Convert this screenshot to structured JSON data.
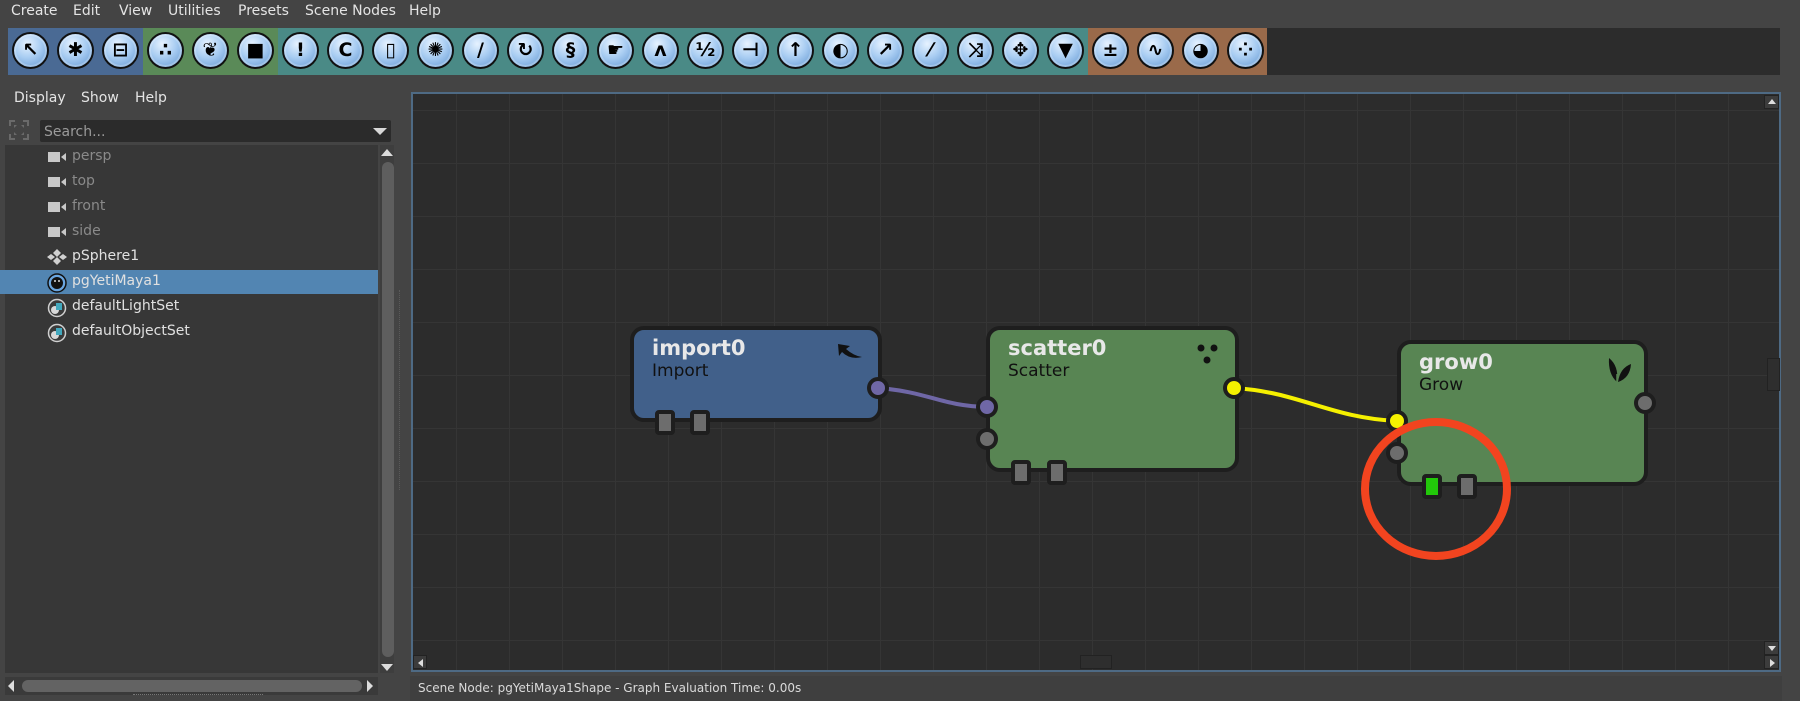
{
  "menubar": {
    "items": [
      "Create",
      "Edit",
      "View",
      "Utilities",
      "Presets",
      "Scene Nodes",
      "Help"
    ]
  },
  "toolbar": {
    "groups": [
      {
        "name": "blue",
        "color": "#4a6a94",
        "icons": [
          "import-icon",
          "puzzle-icon",
          "archive-box-icon"
        ]
      },
      {
        "name": "green",
        "color": "#5a8a58",
        "icons": [
          "scatter-icon",
          "grow-leaf-icon",
          "bucket-icon"
        ]
      },
      {
        "name": "teal",
        "color": "#4a8a86",
        "icons": [
          "exclamation-icon",
          "curl-icon",
          "blender-icon",
          "clump-icon",
          "comb-icon",
          "swirl-icon",
          "squiggle-icon",
          "pointing-hand-icon",
          "noise-icon",
          "split-icon",
          "signpost-icon",
          "direction-arrow-icon",
          "moon-icon",
          "graph-line-icon",
          "brush-icon",
          "shuffle-icon",
          "move-icon",
          "funnel-icon"
        ]
      },
      {
        "name": "brown",
        "color": "#9a6a4a",
        "icons": [
          "calculator-icon",
          "waveform-icon",
          "palette-icon",
          "dot-grid-icon"
        ]
      }
    ],
    "glyphs": {
      "import-icon": "↖",
      "puzzle-icon": "✱",
      "archive-box-icon": "⊟",
      "scatter-icon": "∴",
      "grow-leaf-icon": "❦",
      "bucket-icon": "■",
      "exclamation-icon": "!",
      "curl-icon": "C",
      "blender-icon": "▯",
      "clump-icon": "✺",
      "comb-icon": "/",
      "swirl-icon": "↻",
      "squiggle-icon": "§",
      "pointing-hand-icon": "☛",
      "noise-icon": "ʌ",
      "split-icon": "½",
      "signpost-icon": "⊣",
      "direction-arrow-icon": "↑",
      "moon-icon": "◐",
      "graph-line-icon": "↗",
      "brush-icon": "⁄",
      "shuffle-icon": "⤨",
      "move-icon": "✥",
      "funnel-icon": "▼",
      "calculator-icon": "±",
      "waveform-icon": "∿",
      "palette-icon": "◕",
      "dot-grid-icon": "⁘"
    }
  },
  "left_panel": {
    "menu": [
      "Display",
      "Show",
      "Help"
    ],
    "search": {
      "placeholder": "Search...",
      "value": ""
    },
    "outliner": [
      {
        "label": "persp",
        "icon": "camera-icon",
        "dim": true,
        "selected": false
      },
      {
        "label": "top",
        "icon": "camera-icon",
        "dim": true,
        "selected": false
      },
      {
        "label": "front",
        "icon": "camera-icon",
        "dim": true,
        "selected": false
      },
      {
        "label": "side",
        "icon": "camera-icon",
        "dim": true,
        "selected": false
      },
      {
        "label": "pSphere1",
        "icon": "mesh-icon",
        "dim": false,
        "selected": false
      },
      {
        "label": "pgYetiMaya1",
        "icon": "yeti-icon",
        "dim": false,
        "selected": true
      },
      {
        "label": "defaultLightSet",
        "icon": "set-icon",
        "dim": false,
        "selected": false
      },
      {
        "label": "defaultObjectSet",
        "icon": "set-icon",
        "dim": false,
        "selected": false
      }
    ]
  },
  "graph": {
    "nodes": [
      {
        "id": "import0",
        "title": "import0",
        "type": "Import",
        "color": "#41608a",
        "icon": "import-arrow-icon"
      },
      {
        "id": "scatter0",
        "title": "scatter0",
        "type": "Scatter",
        "color": "#588553",
        "icon": "scatter-dots-icon"
      },
      {
        "id": "grow0",
        "title": "grow0",
        "type": "Grow",
        "color": "#588553",
        "icon": "leaf-icon"
      }
    ],
    "connections": [
      {
        "from": "import0",
        "to": "scatter0",
        "color": "#6f67a6"
      },
      {
        "from": "scatter0",
        "to": "grow0",
        "color": "#f5f000"
      }
    ],
    "colors": {
      "port_default": "#6d6d6d",
      "port_purple": "#6f67a6",
      "port_yellow": "#f5f000",
      "tab_active": "#22c80a",
      "highlight_circle": "#f2441f"
    }
  },
  "status": {
    "text": "Scene Node: pgYetiMaya1Shape - Graph Evaluation Time: 0.00s"
  }
}
